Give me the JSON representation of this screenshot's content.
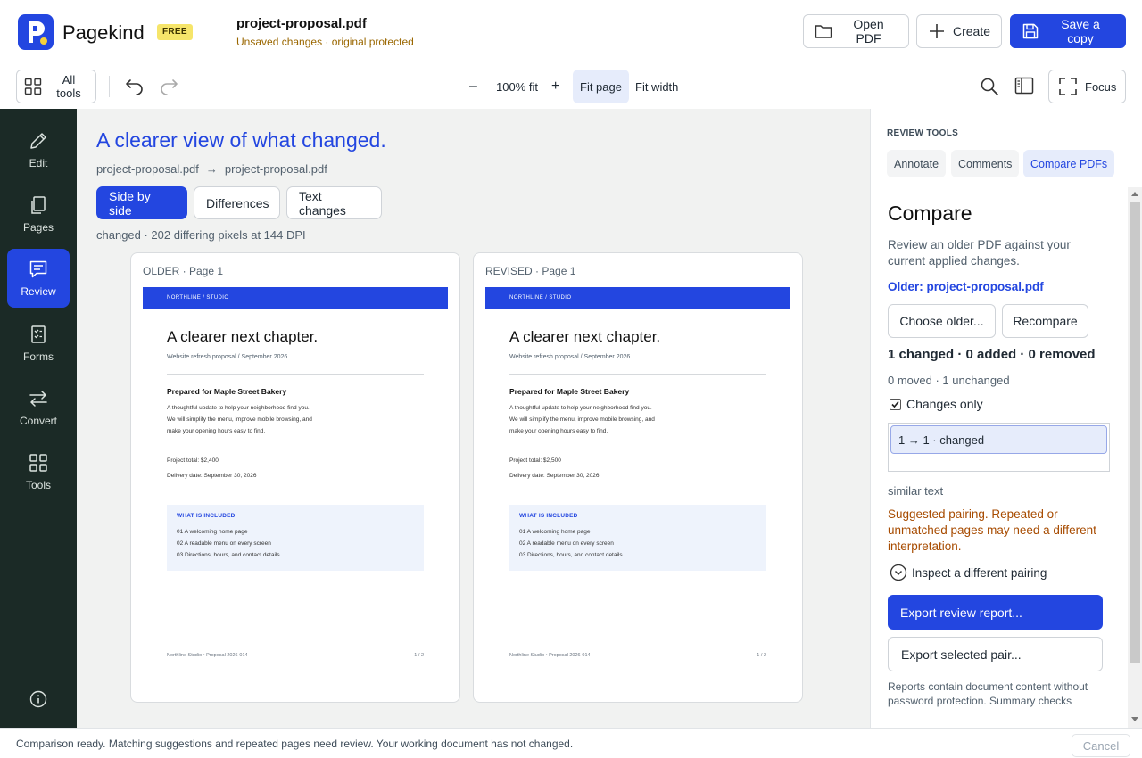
{
  "app": {
    "brand": "Pagekind",
    "plan_badge": "FREE",
    "file_name": "project-proposal.pdf",
    "file_status": "Unsaved changes · original protected",
    "open_pdf": "Open PDF",
    "create": "Create",
    "save_copy": "Save a copy",
    "accent": "#2346e0"
  },
  "toolbar": {
    "all_tools": "All tools",
    "zoom_out": "–",
    "zoom_level": "100% fit",
    "zoom_in": "+",
    "fit_page": "Fit page",
    "fit_width": "Fit width",
    "focus": "Focus"
  },
  "sidebar": {
    "items": [
      {
        "label": "Edit",
        "icon": "pencil-icon"
      },
      {
        "label": "Pages",
        "icon": "pages-icon"
      },
      {
        "label": "Review",
        "icon": "comment-icon",
        "active": true
      },
      {
        "label": "Forms",
        "icon": "form-icon"
      },
      {
        "label": "Convert",
        "icon": "convert-icon"
      },
      {
        "label": "Tools",
        "icon": "grid-icon"
      }
    ],
    "info_icon": "info-icon"
  },
  "main": {
    "title": "A clearer view of what changed.",
    "older_file": "project-proposal.pdf",
    "arrow": "→",
    "revised_file": "project-proposal.pdf",
    "views": [
      "Side by side",
      "Differences",
      "Text changes"
    ],
    "diff_info": "changed · 202 differing pixels at 144 DPI",
    "older_label": "OLDER · Page 1",
    "revised_label": "REVISED · Page 1",
    "older_doc": {
      "band": "NORTHLINE  /  STUDIO",
      "heading": "A clearer next chapter.",
      "subtitle": "Website refresh proposal  /  September 2026",
      "prepared": "Prepared for Maple Street Bakery",
      "lines": [
        "A thoughtful update to help your neighborhood find you.",
        "We will simplify the menu, improve mobile browsing, and",
        "make your opening hours easy to find."
      ],
      "total": "Project total: $2,400",
      "delivery": "Delivery date: September 30, 2026",
      "included_title": "WHAT IS INCLUDED",
      "included": [
        "01   A welcoming home page",
        "02   A readable menu on every screen",
        "03   Directions, hours, and contact details"
      ],
      "footer_left": "Northline Studio  •  Proposal 2026-014",
      "footer_right": "1 / 2"
    },
    "revised_doc": {
      "band": "NORTHLINE  /  STUDIO",
      "heading": "A clearer next chapter.",
      "subtitle": "Website refresh proposal  /  September 2026",
      "prepared": "Prepared for Maple Street Bakery",
      "lines": [
        "A thoughtful update to help your neighborhood find you.",
        "We will simplify the menu, improve mobile browsing, and",
        "make your opening hours easy to find."
      ],
      "total": "Project total: $2,500",
      "delivery": "Delivery date: September 30, 2026",
      "included_title": "WHAT IS INCLUDED",
      "included": [
        "01   A welcoming home page",
        "02   A readable menu on every screen",
        "03   Directions, hours, and contact details"
      ],
      "footer_left": "Northline Studio  •  Proposal 2026-014",
      "footer_right": "1 / 2"
    }
  },
  "review_panel": {
    "heading": "REVIEW TOOLS",
    "tabs": [
      "Annotate",
      "Comments",
      "Compare PDFs"
    ],
    "title": "Compare",
    "description": "Review an older PDF against your current applied changes.",
    "older": "Older: project-proposal.pdf",
    "choose_older": "Choose older...",
    "recompare": "Recompare",
    "summary": "1 changed · 0 added · 0 removed",
    "moved": "0 moved · 1 unchanged",
    "changes_only": "Changes only",
    "pair_item": "1 → 1  ·  changed",
    "similar": "similar text",
    "warning": "Suggested pairing. Repeated or unmatched pages may need a different interpretation.",
    "inspect": "Inspect a different pairing",
    "export_report": "Export review report...",
    "export_pair": "Export selected pair...",
    "note": "Reports contain document content without password protection. Summary checks"
  },
  "status": {
    "message": "Comparison ready. Matching suggestions and repeated pages need review. Your working document has not changed.",
    "cancel": "Cancel"
  }
}
